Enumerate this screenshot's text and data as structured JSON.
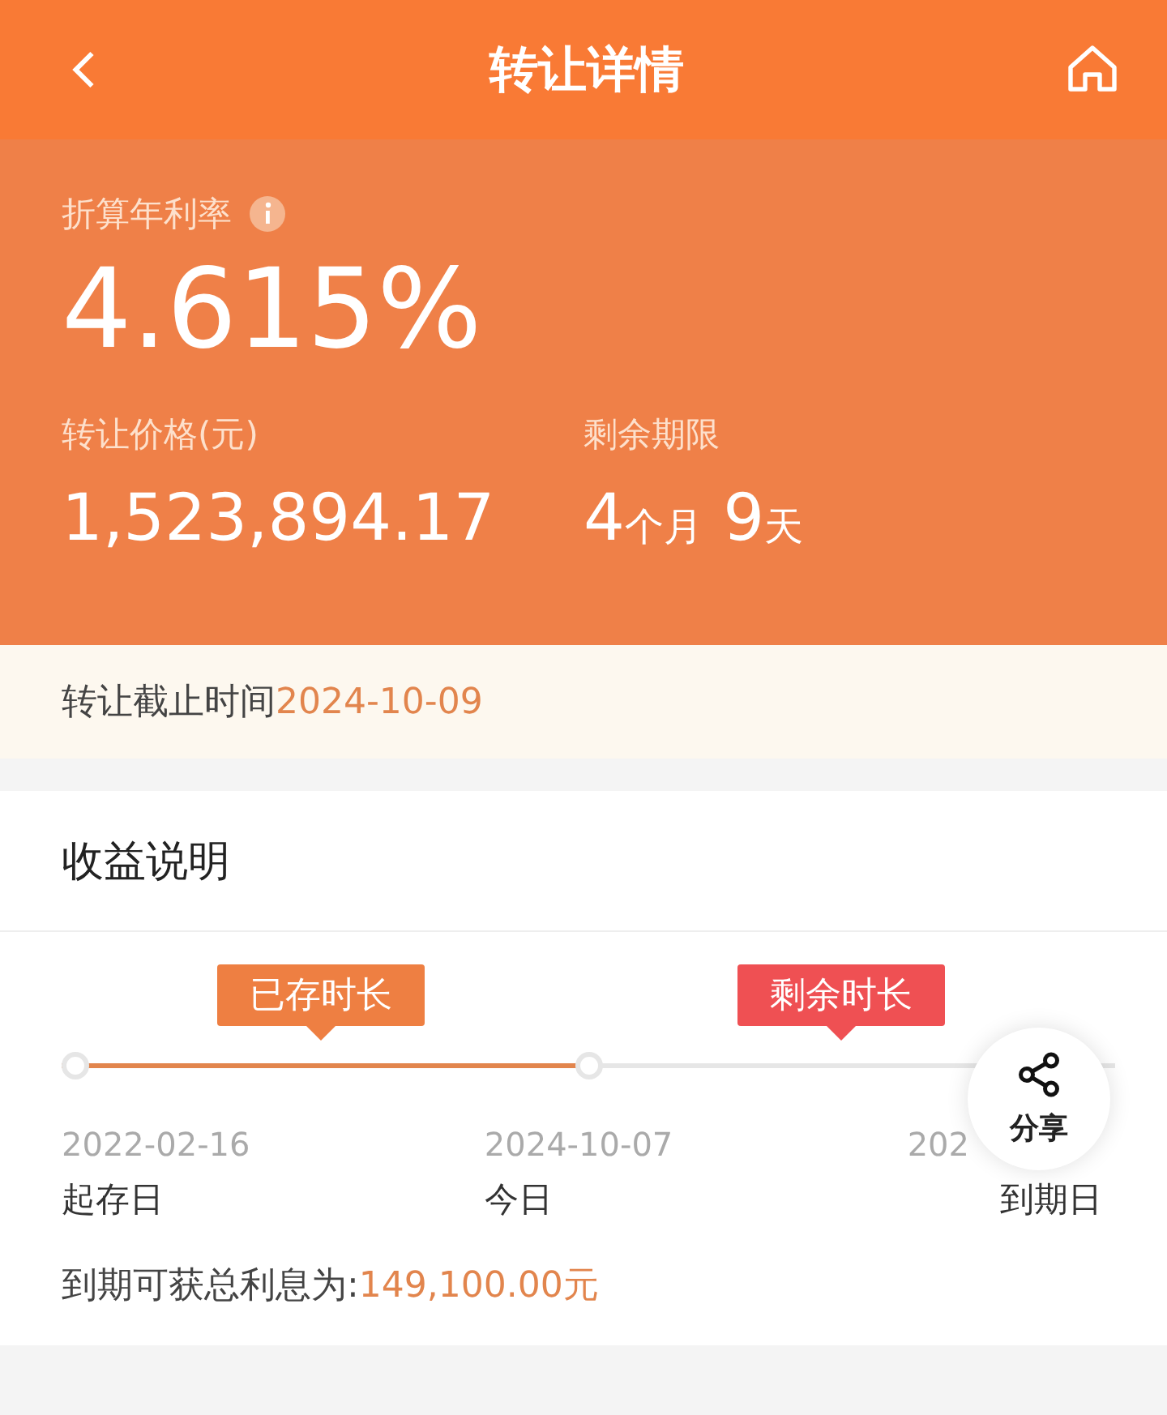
{
  "header": {
    "title": "转让详情"
  },
  "summary": {
    "rate_label": "折算年利率",
    "rate": "4.615%",
    "price_label": "转让价格(元)",
    "price": "1,523,894.17",
    "term_label": "剩余期限",
    "term_parts": [
      {
        "kind": "num",
        "text": "4"
      },
      {
        "kind": "unit",
        "text": "个月"
      },
      {
        "kind": "num",
        "text": " 9"
      },
      {
        "kind": "unit",
        "text": "天"
      }
    ]
  },
  "deadline": {
    "label": "转让截止时间",
    "value": "2024-10-09"
  },
  "earnings": {
    "title": "收益说明",
    "tags": [
      {
        "text": "已存时长",
        "color": "#ee7f42"
      },
      {
        "text": "剩余时长",
        "color": "#ef5053"
      }
    ],
    "level": 0.5,
    "points": [
      {
        "date": "2022-02-16",
        "label": "起存日"
      },
      {
        "date": "2024-10-07",
        "label": "今日"
      },
      {
        "date": "202",
        "label": "到期日"
      }
    ],
    "interest_label": "到期可获总利息为:",
    "interest_value": "149,100.00元"
  },
  "share": {
    "label": "分享"
  }
}
